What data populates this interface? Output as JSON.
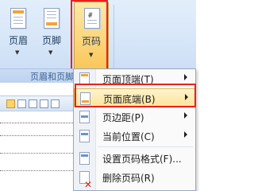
{
  "ribbon": {
    "buttons": [
      {
        "label": "页眉",
        "icon": "header-icon"
      },
      {
        "label": "页脚",
        "icon": "footer-icon"
      },
      {
        "label": "页码",
        "icon": "page-number-icon"
      }
    ],
    "group_label": "页眉和页脚"
  },
  "menu": {
    "items": [
      {
        "label": "页面顶端(T)",
        "icon": "page-top-icon",
        "has_submenu": true
      },
      {
        "label": "页面底端(B)",
        "icon": "page-bottom-icon",
        "has_submenu": true,
        "highlighted": true
      },
      {
        "label": "页边距(P)",
        "icon": "page-margin-icon",
        "has_submenu": true
      },
      {
        "label": "当前位置(C)",
        "icon": "current-position-icon",
        "has_submenu": true
      },
      {
        "label": "设置页码格式(F)...",
        "icon": "format-page-number-icon",
        "has_submenu": false
      },
      {
        "label": "删除页码(R)",
        "icon": "delete-page-number-icon",
        "has_submenu": false
      }
    ]
  },
  "colors": {
    "highlight": "#fde59a",
    "annotation_red": "#e8211c"
  }
}
